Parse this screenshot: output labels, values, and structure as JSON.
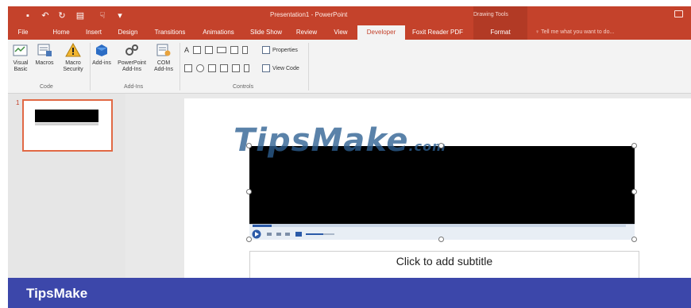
{
  "window": {
    "title": "Presentation1 - PowerPoint",
    "context_tab_group": "Drawing Tools"
  },
  "ribbon_tabs": [
    "File",
    "Home",
    "Insert",
    "Design",
    "Transitions",
    "Animations",
    "Slide Show",
    "Review",
    "View",
    "Developer",
    "Foxit Reader PDF",
    "Format"
  ],
  "active_tab": "Developer",
  "tell_me": "Tell me what you want to do...",
  "ribbon": {
    "code": {
      "label": "Code",
      "visual_basic": "Visual Basic",
      "macros": "Macros",
      "macro_security": "Macro Security"
    },
    "addins": {
      "label": "Add-Ins",
      "addins": "Add-ins",
      "powerpoint_addins": "PowerPoint Add-Ins",
      "com_addins": "COM Add-Ins"
    },
    "controls": {
      "label": "Controls",
      "properties": "Properties",
      "view_code": "View Code"
    }
  },
  "thumbnail": {
    "slide_number": "1"
  },
  "slide": {
    "subtitle_placeholder": "Click to add subtitle",
    "watermark": "TipsMake",
    "watermark_suffix": ".com"
  },
  "footer": {
    "brand": "TipsMake"
  },
  "colors": {
    "titlebar": "#c4422b",
    "footer": "#3c47aa",
    "thumbnail_border": "#e16945"
  }
}
